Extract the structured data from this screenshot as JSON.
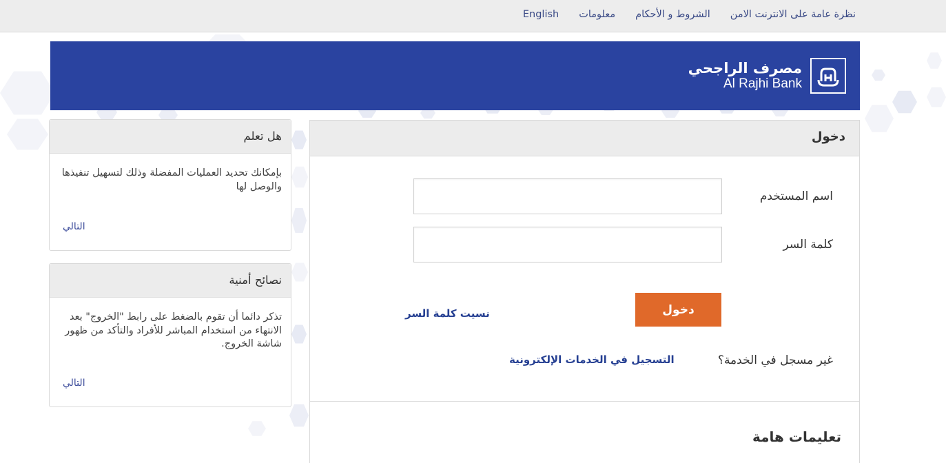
{
  "topnav": {
    "items": [
      {
        "label": "نظرة عامة على الانترنت الامن"
      },
      {
        "label": "الشروط و الأحكام"
      },
      {
        "label": "معلومات"
      },
      {
        "label": "English"
      }
    ]
  },
  "banner": {
    "logo_ar": "مصرف الراجحي",
    "logo_en": "Al Rajhi Bank",
    "logo_icon": "al-rajhi-logo-icon",
    "background_color": "#2a43a0"
  },
  "login": {
    "title": "دخول",
    "username_label": "اسم المستخدم",
    "username_value": "",
    "password_label": "كلمة السر",
    "password_value": "",
    "login_button": "دخول",
    "forgot_password": "نسيت كلمة السر",
    "not_registered": "غير مسجل في الخدمة؟",
    "register_link": "التسجيل في الخدمات الإلكترونية",
    "important_title": "تعليمات هامة",
    "button_color": "#e0692a"
  },
  "did_you_know": {
    "title": "هل تعلم",
    "body": "بإمكانك تحديد العمليات المفضلة وذلك لتسهيل تنفيذها والوصل لها",
    "next": "التالي"
  },
  "security_tips": {
    "title": "نصائح أمنية",
    "body": "تذكر دائما أن تقوم بالضغط على رابط \"الخروج\" بعد الانتهاء من استخدام المباشر للأفراد والتأكد من ظهور شاشة الخروج.",
    "next": "التالي"
  }
}
